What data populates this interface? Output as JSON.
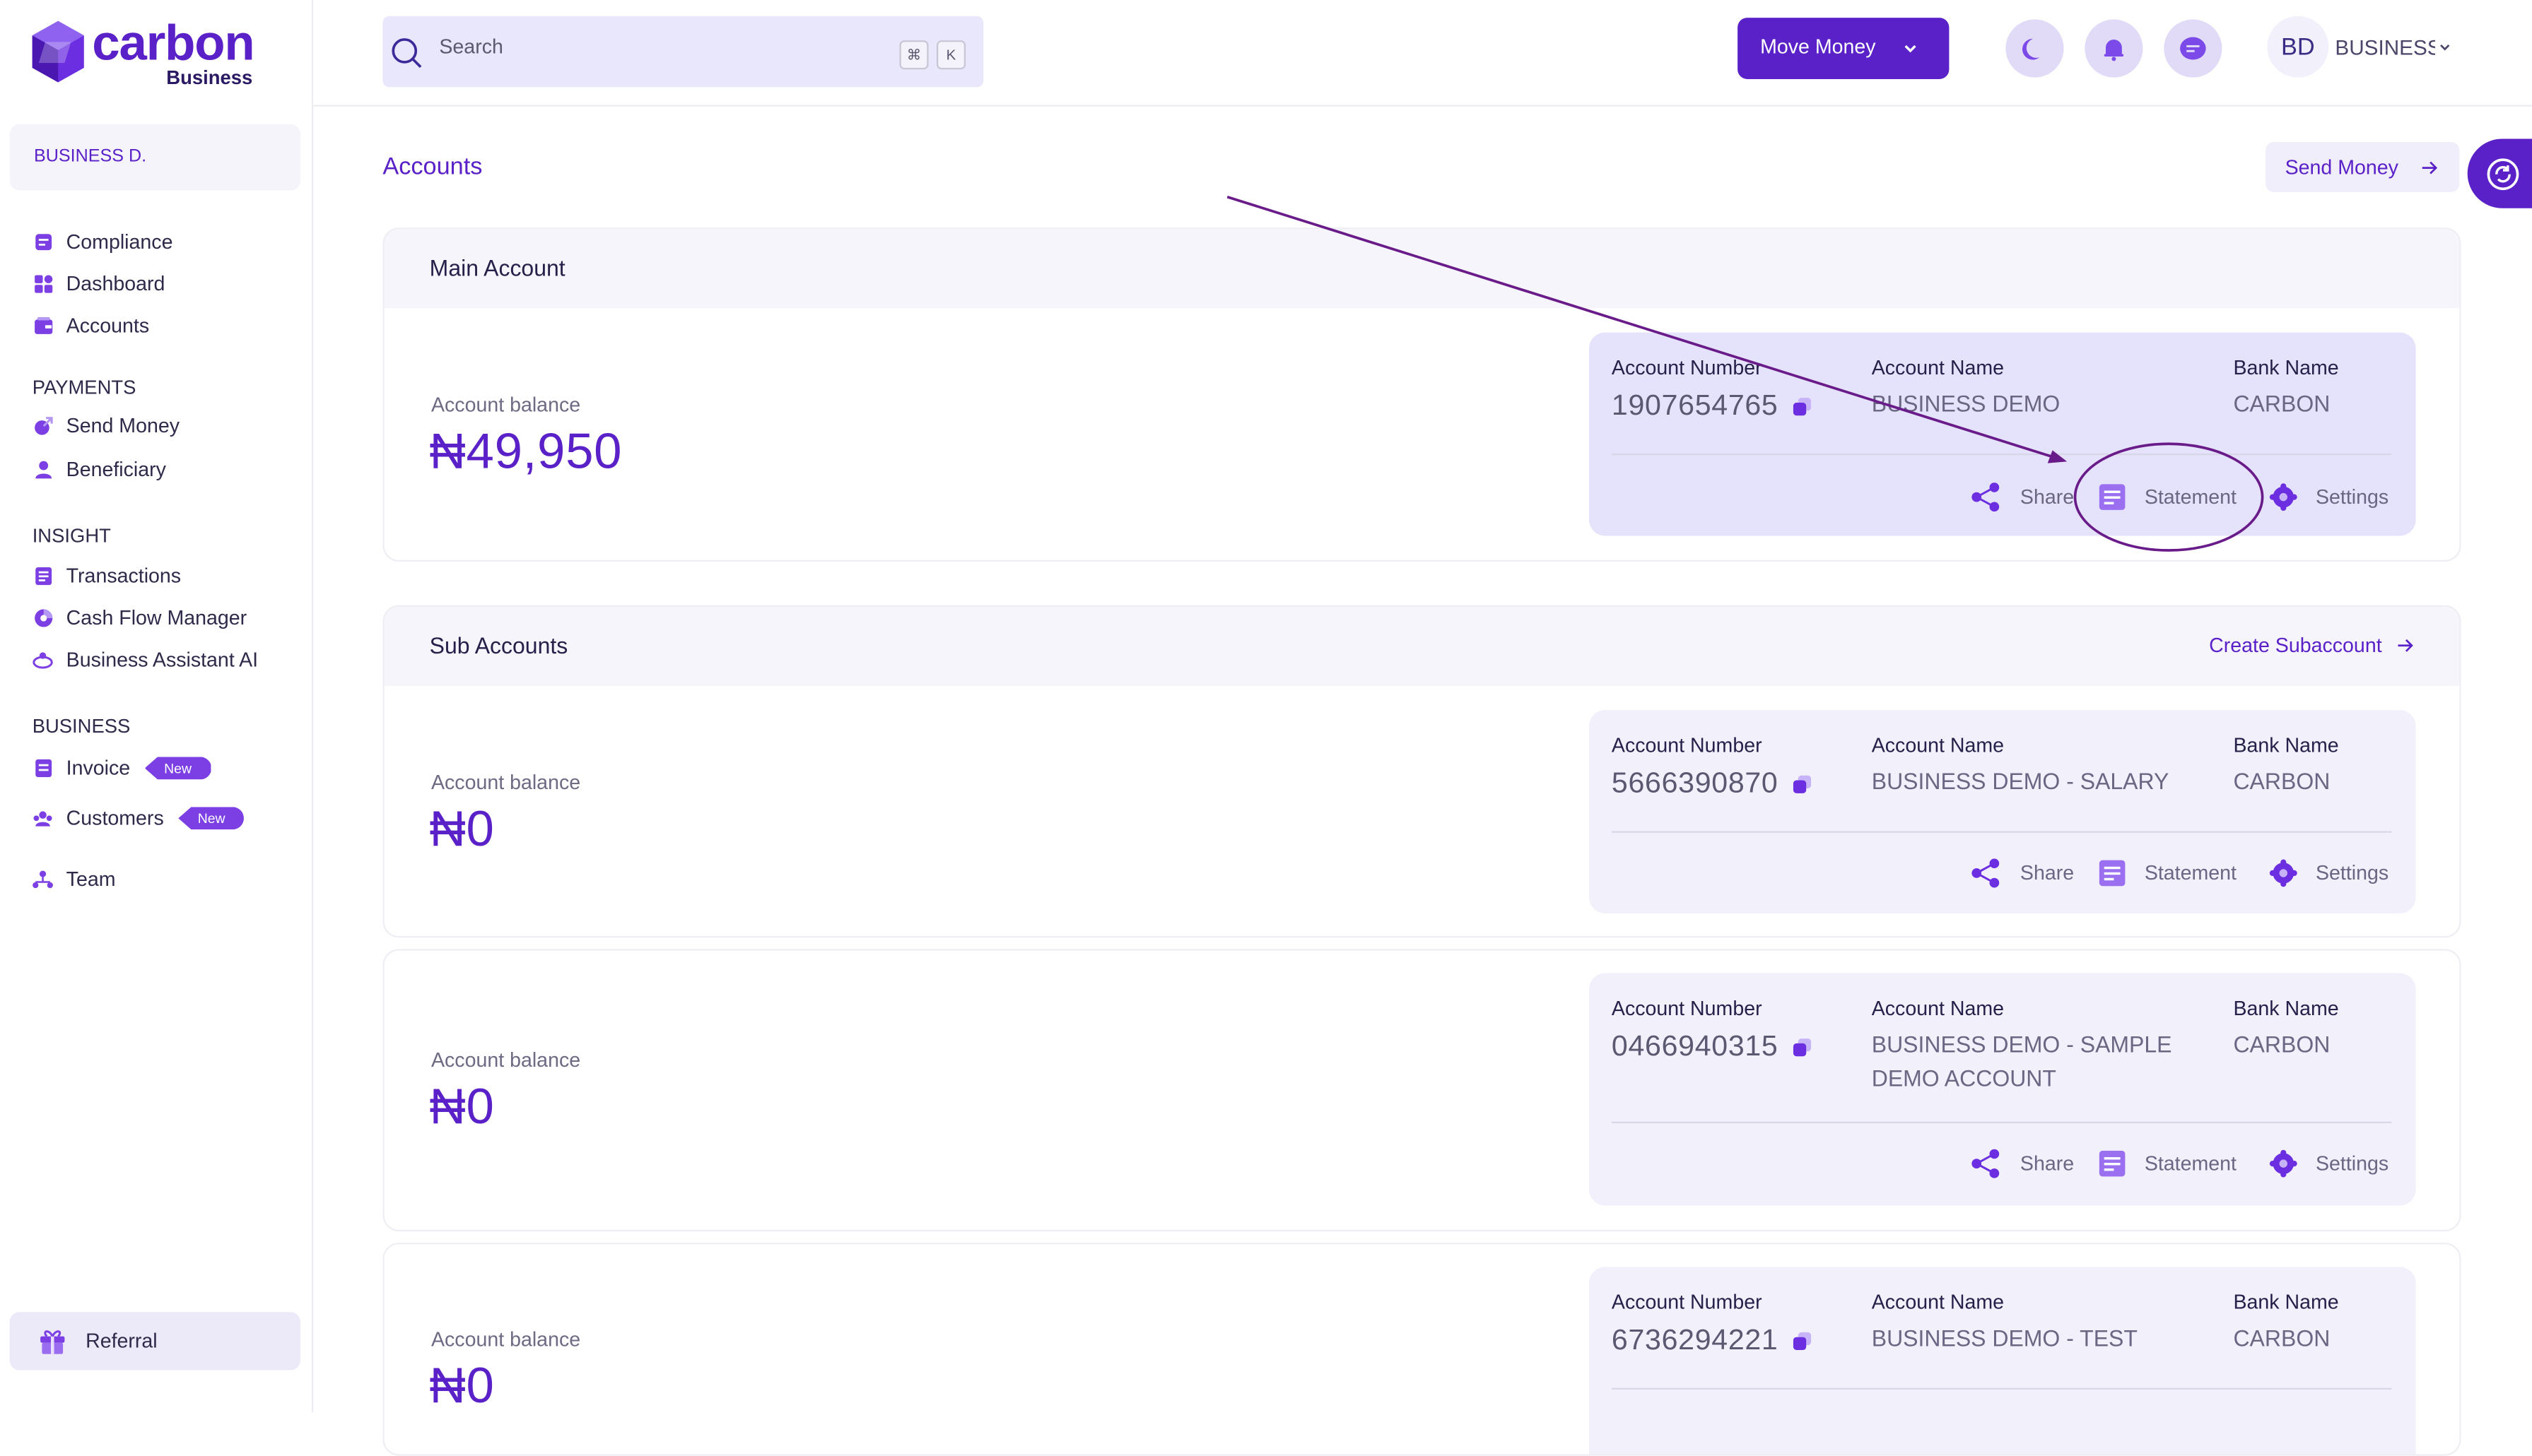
{
  "brand": {
    "logo_text": "carbon",
    "logo_sub": "Business"
  },
  "business": {
    "name": "BUSINESS D."
  },
  "sidebar": {
    "main_items": [
      {
        "label": "Compliance"
      },
      {
        "label": "Dashboard"
      },
      {
        "label": "Accounts"
      }
    ],
    "sections": {
      "payments": {
        "title": "PAYMENTS",
        "items": [
          {
            "label": "Send Money"
          },
          {
            "label": "Beneficiary"
          }
        ]
      },
      "insight": {
        "title": "INSIGHT",
        "items": [
          {
            "label": "Transactions"
          },
          {
            "label": "Cash Flow Manager"
          },
          {
            "label": "Business Assistant AI"
          }
        ]
      },
      "business": {
        "title": "BUSINESS",
        "items": [
          {
            "label": "Invoice",
            "badge": "New"
          },
          {
            "label": "Customers",
            "badge": "New"
          },
          {
            "label": "Team"
          }
        ]
      }
    },
    "referral": "Referral"
  },
  "topbar": {
    "search_placeholder": "Search",
    "shortcut": [
      "⌘",
      "K"
    ],
    "move_money": "Move Money",
    "user_initials": "BD",
    "user_name": "BUSINESS DEMO"
  },
  "page": {
    "title": "Accounts",
    "send_money": "Send Money"
  },
  "labels": {
    "account_number": "Account Number",
    "account_name": "Account Name",
    "bank_name": "Bank Name",
    "account_balance": "Account balance",
    "share": "Share",
    "statement": "Statement",
    "settings": "Settings"
  },
  "main_account": {
    "title": "Main Account",
    "balance": "₦49,950",
    "number": "1907654765",
    "name": "BUSINESS DEMO",
    "bank": "CARBON"
  },
  "sub_accounts": {
    "title": "Sub Accounts",
    "create": "Create Subaccount",
    "items": [
      {
        "balance": "₦0",
        "number": "5666390870",
        "name": "BUSINESS DEMO - SALARY",
        "bank": "CARBON"
      },
      {
        "balance": "₦0",
        "number": "0466940315",
        "name": "BUSINESS DEMO - SAMPLE DEMO ACCOUNT",
        "bank": "CARBON"
      },
      {
        "balance": "₦0",
        "number": "6736294221",
        "name": "BUSINESS DEMO - TEST",
        "bank": "CARBON"
      }
    ]
  },
  "colors": {
    "accent": "#5b21c8",
    "annotation": "#6a1b8a",
    "panel": "#f1f0fb"
  }
}
